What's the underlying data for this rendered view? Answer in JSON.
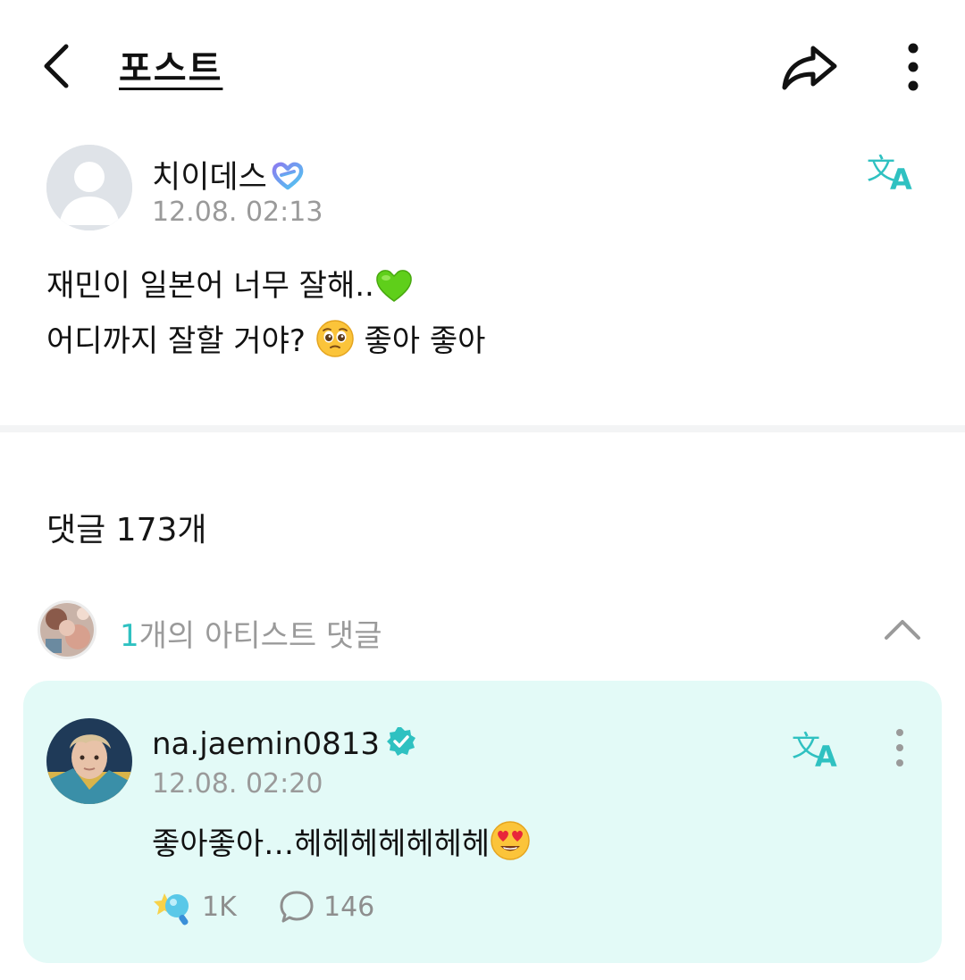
{
  "header": {
    "title": "포스트",
    "back_icon": "chevron-left-icon",
    "share_icon": "share-arrow-icon",
    "more_icon": "vertical-dots-icon"
  },
  "post": {
    "author": "치이데스",
    "author_badge_icon": "membership-heart-icon",
    "time": "12.08. 02:13",
    "translate_icon": "translate-icon",
    "line1": "재민이 일본어 너무 잘해..",
    "line1_emoji": "green-heart-emoji",
    "line2a": "어디까지 잘할 거야?",
    "line2_emoji": "pleading-face-emoji",
    "line2b": "좋아 좋아"
  },
  "comments": {
    "count_label": "댓글 173개"
  },
  "artist_comments": {
    "count": "1",
    "label": "개의 아티스트 댓글",
    "toggle_icon": "chevron-up-icon"
  },
  "artist_comment": {
    "author": "na.jaemin0813",
    "verified_icon": "verified-check-icon",
    "time": "12.08. 02:20",
    "text": "좋아좋아…헤헤헤헤헤헤헤",
    "text_emoji": "heart-eyes-emoji",
    "likes": "1K",
    "likes_icon": "lightstick-icon",
    "replies": "146",
    "replies_icon": "speech-bubble-icon",
    "translate_icon": "translate-icon",
    "more_icon": "vertical-dots-icon"
  },
  "colors": {
    "accent": "#2fc1c1",
    "card_bg": "#e3faf7",
    "muted_text": "#9a9a9a"
  }
}
